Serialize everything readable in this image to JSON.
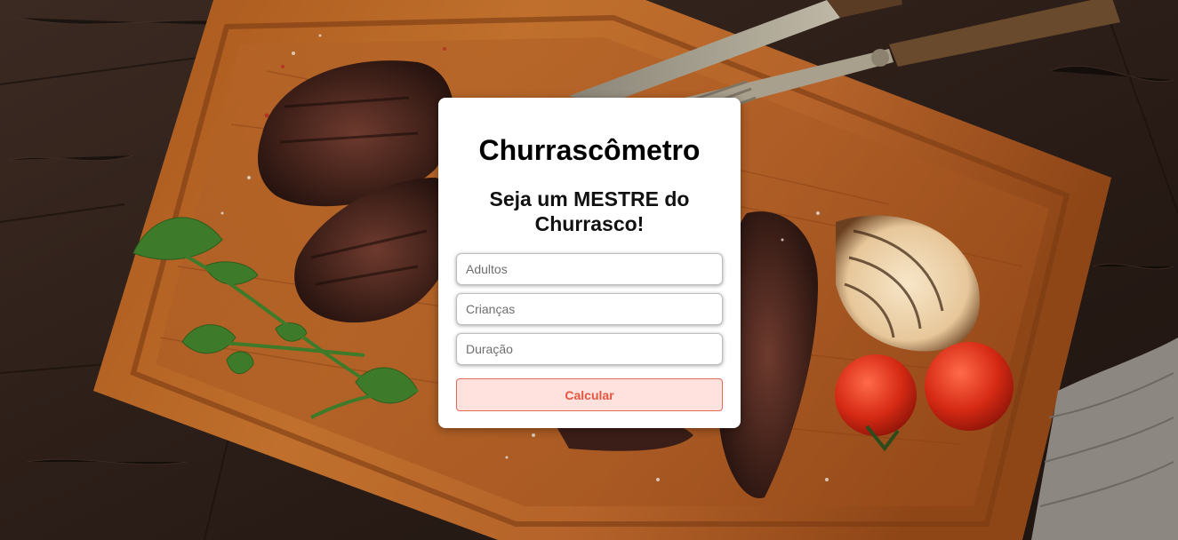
{
  "form": {
    "title": "Churrascômetro",
    "subtitle": "Seja um MESTRE do Churrasco!",
    "adults_placeholder": "Adultos",
    "children_placeholder": "Crianças",
    "duration_placeholder": "Duração",
    "calculate_label": "Calcular"
  },
  "colors": {
    "button_bg": "#ffe1dd",
    "button_text": "#e4563f",
    "button_border": "#e26a5c"
  }
}
